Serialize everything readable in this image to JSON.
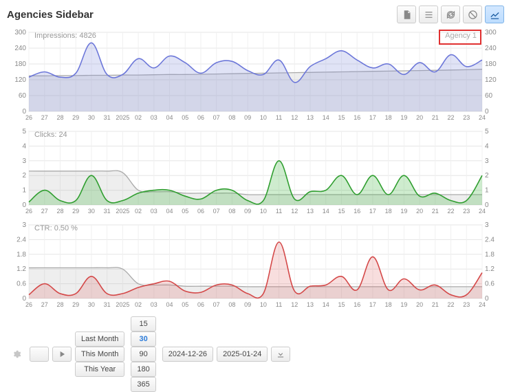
{
  "title": "Agencies Sidebar",
  "agency_label": "Agency 1",
  "toolbar_icons": [
    "document",
    "list",
    "refresh",
    "block",
    "chart"
  ],
  "toolbar_active": "chart",
  "chart_data": [
    {
      "type": "area",
      "title": "Impressions: 4826",
      "color": "#6c77d9",
      "fill": "rgba(130,142,220,0.25)",
      "bg_color": "#aaa",
      "bg_fill": "rgba(170,170,170,0.20)",
      "xlabels": [
        "26",
        "27",
        "28",
        "29",
        "30",
        "31",
        "2025",
        "02",
        "03",
        "04",
        "05",
        "06",
        "07",
        "08",
        "09",
        "10",
        "11",
        "12",
        "13",
        "14",
        "15",
        "16",
        "17",
        "18",
        "19",
        "20",
        "21",
        "22",
        "23",
        "24"
      ],
      "ylim": [
        0,
        300
      ],
      "yticks": [
        0,
        60,
        120,
        180,
        240,
        300
      ],
      "values": [
        130,
        150,
        130,
        145,
        260,
        140,
        140,
        200,
        165,
        210,
        185,
        145,
        185,
        190,
        155,
        140,
        195,
        110,
        170,
        200,
        230,
        195,
        165,
        180,
        140,
        185,
        150,
        215,
        170,
        195
      ],
      "bg_values": [
        135,
        135,
        136,
        136,
        137,
        137,
        138,
        138,
        139,
        140,
        140,
        141,
        142,
        143,
        144,
        145,
        146,
        147,
        148,
        149,
        150,
        151,
        152,
        153,
        154,
        155,
        156,
        157,
        158,
        160
      ]
    },
    {
      "type": "area",
      "title": "Clicks: 24",
      "color": "#2f9e2f",
      "fill": "rgba(60,180,60,0.25)",
      "bg_color": "#aaa",
      "bg_fill": "rgba(170,170,170,0.20)",
      "xlabels": [
        "26",
        "27",
        "28",
        "29",
        "30",
        "31",
        "2025",
        "02",
        "03",
        "04",
        "05",
        "06",
        "07",
        "08",
        "09",
        "10",
        "11",
        "12",
        "13",
        "14",
        "15",
        "16",
        "17",
        "18",
        "19",
        "20",
        "21",
        "22",
        "23",
        "24"
      ],
      "ylim": [
        0,
        5
      ],
      "yticks": [
        0,
        1,
        2,
        3,
        4,
        5
      ],
      "values": [
        0.2,
        1.0,
        0.3,
        0.3,
        2.0,
        0.3,
        0.3,
        0.8,
        1.0,
        1.0,
        0.6,
        0.4,
        1.0,
        1.0,
        0.3,
        0.3,
        3.0,
        0.4,
        0.9,
        1.0,
        2.0,
        0.7,
        2.0,
        0.7,
        2.0,
        0.6,
        0.8,
        0.3,
        0.3,
        2.0
      ],
      "bg_values": [
        2.3,
        2.3,
        2.3,
        2.3,
        2.3,
        2.3,
        2.2,
        1.0,
        0.9,
        0.9,
        0.8,
        0.8,
        0.8,
        0.8,
        0.7,
        0.7,
        0.7,
        0.7,
        0.7,
        0.7,
        0.7,
        0.7,
        0.7,
        0.7,
        0.7,
        0.7,
        0.7,
        0.7,
        0.7,
        0.7
      ]
    },
    {
      "type": "area",
      "title": "CTR: 0.50 %",
      "color": "#d44848",
      "fill": "rgba(220,90,90,0.20)",
      "bg_color": "#aaa",
      "bg_fill": "rgba(170,170,170,0.20)",
      "xlabels": [
        "26",
        "27",
        "28",
        "29",
        "30",
        "31",
        "2025",
        "02",
        "03",
        "04",
        "05",
        "06",
        "07",
        "08",
        "09",
        "10",
        "11",
        "12",
        "13",
        "14",
        "15",
        "16",
        "17",
        "18",
        "19",
        "20",
        "21",
        "22",
        "23",
        "24"
      ],
      "ylim": [
        0,
        3
      ],
      "yticks": [
        0,
        0.6,
        1.2,
        1.8,
        2.4,
        3
      ],
      "values": [
        0.15,
        0.6,
        0.2,
        0.2,
        0.9,
        0.2,
        0.2,
        0.45,
        0.6,
        0.7,
        0.3,
        0.25,
        0.55,
        0.55,
        0.2,
        0.2,
        2.3,
        0.3,
        0.5,
        0.55,
        0.9,
        0.35,
        1.7,
        0.35,
        0.8,
        0.35,
        0.55,
        0.15,
        0.15,
        1.05
      ],
      "bg_values": [
        1.25,
        1.25,
        1.25,
        1.25,
        1.25,
        1.25,
        1.2,
        0.6,
        0.55,
        0.55,
        0.5,
        0.5,
        0.5,
        0.5,
        0.48,
        0.48,
        0.48,
        0.48,
        0.48,
        0.48,
        0.48,
        0.48,
        0.48,
        0.48,
        0.48,
        0.48,
        0.48,
        0.48,
        0.48,
        0.48
      ]
    }
  ],
  "footer": {
    "ranges": [
      "Last Month",
      "This Month",
      "This Year"
    ],
    "days": [
      "15",
      "30",
      "90",
      "180",
      "365"
    ],
    "days_selected": "30",
    "date_from": "2024-12-26",
    "date_to": "2025-01-24"
  }
}
